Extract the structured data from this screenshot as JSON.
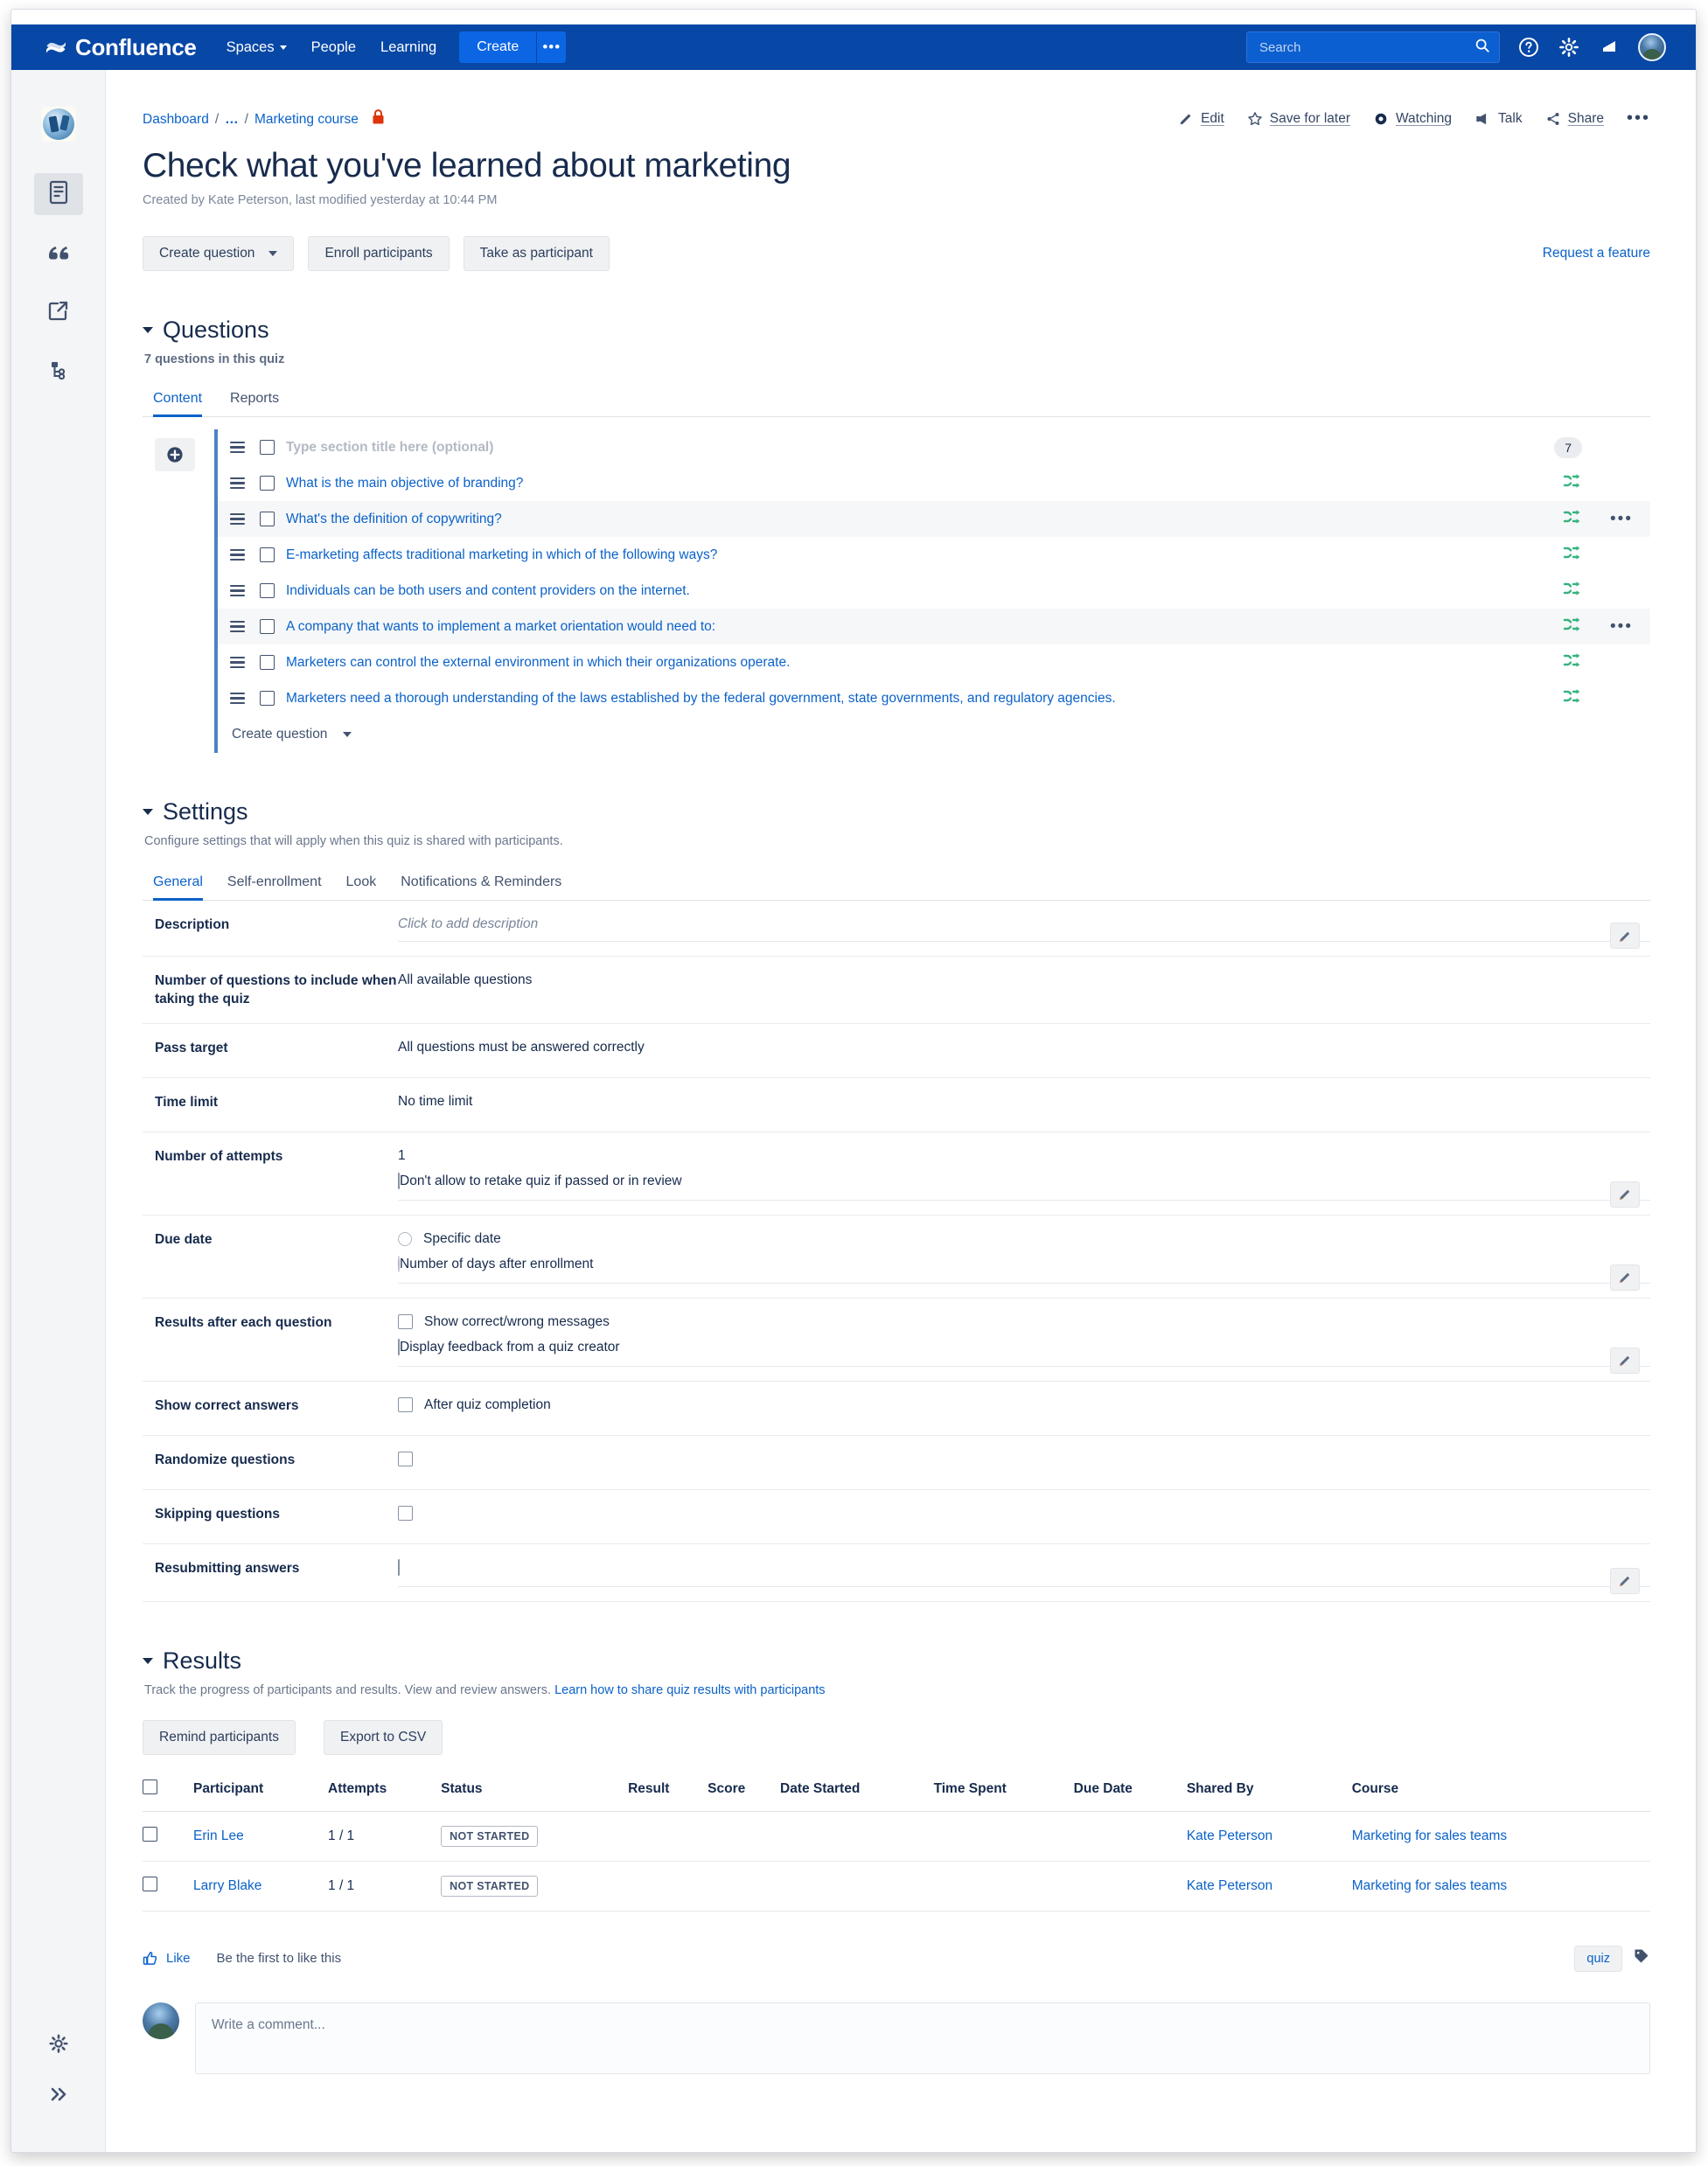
{
  "nav": {
    "brand": "Confluence",
    "items": [
      {
        "label": "Spaces",
        "has_caret": true
      },
      {
        "label": "People",
        "has_caret": false
      },
      {
        "label": "Learning",
        "has_caret": false
      }
    ],
    "create_label": "Create",
    "create_more_label": "•••",
    "search_placeholder": "Search",
    "icons": [
      "search-icon",
      "help-icon",
      "settings-icon",
      "notifications-icon",
      "profile-avatar"
    ]
  },
  "sidebar": {
    "items": [
      {
        "name": "space-logo",
        "label": "Marketing course space"
      },
      {
        "name": "pages-icon",
        "label": "Pages",
        "active": true
      },
      {
        "name": "blog-quote-icon",
        "label": "Blog"
      },
      {
        "name": "shortcut-link-icon",
        "label": "Shortcut"
      },
      {
        "name": "page-tree-icon",
        "label": "Page tree"
      }
    ],
    "bottom": [
      {
        "name": "space-settings-icon",
        "label": "Space settings"
      },
      {
        "name": "expand-sidebar-icon",
        "label": "Expand sidebar"
      }
    ]
  },
  "breadcrumb": {
    "dashboard": "Dashboard",
    "sep": "/",
    "dots": "…",
    "space": "Marketing course",
    "restricted_icon": "lock-icon"
  },
  "page": {
    "title": "Check what you've learned about marketing",
    "meta": "Created by Kate Peterson, last modified yesterday at 10:44 PM"
  },
  "page_actions": [
    {
      "label": "Edit",
      "icon": "pencil-icon"
    },
    {
      "label": "Save for later",
      "icon": "star-icon"
    },
    {
      "label": "Watching",
      "icon": "eye-icon"
    },
    {
      "label": "Talk",
      "icon": "megaphone-icon"
    },
    {
      "label": "Share",
      "icon": "share-icon"
    },
    {
      "label": "•••",
      "icon": "more-actions-icon"
    }
  ],
  "toolbar": {
    "create_question": "Create question",
    "enroll_participants": "Enroll participants",
    "take_as_participant": "Take as participant",
    "request_feature": "Request a feature"
  },
  "questions_section": {
    "title": "Questions",
    "subtitle": "7 questions in this quiz",
    "tabs": [
      {
        "label": "Content",
        "active": true
      },
      {
        "label": "Reports",
        "active": false
      }
    ],
    "section_row": {
      "placeholder": "Type section title here (optional)",
      "count_badge": "7"
    },
    "items": [
      {
        "text": "What is the main objective of branding?",
        "alt": false,
        "has_dots": false
      },
      {
        "text": "What's the definition of copywriting?",
        "alt": true,
        "has_dots": true
      },
      {
        "text": "E-marketing affects traditional marketing in which of the following ways?",
        "alt": false,
        "has_dots": false
      },
      {
        "text": "Individuals can be both users and content providers on the internet.",
        "alt": false,
        "has_dots": false
      },
      {
        "text": "A company that wants to implement a market orientation would need to:",
        "alt": true,
        "has_dots": true
      },
      {
        "text": "Marketers can control the external environment in which their organizations operate.",
        "alt": false,
        "has_dots": false
      },
      {
        "text": "Marketers need a thorough understanding of the laws established by the federal government, state governments, and regulatory agencies.",
        "alt": false,
        "has_dots": false
      }
    ],
    "create_question_footer": "Create question"
  },
  "settings_section": {
    "title": "Settings",
    "subtitle": "Configure settings that will apply when this quiz is shared with participants.",
    "tabs": [
      {
        "label": "General",
        "active": true
      },
      {
        "label": "Self-enrollment",
        "active": false
      },
      {
        "label": "Look",
        "active": false
      },
      {
        "label": "Notifications & Reminders",
        "active": false
      }
    ],
    "rows": {
      "description": {
        "label": "Description",
        "placeholder": "Click to add description"
      },
      "num_questions": {
        "label": "Number of questions to include when taking the quiz",
        "value": "All available questions"
      },
      "pass_target": {
        "label": "Pass target",
        "value": "All questions must be answered correctly"
      },
      "time_limit": {
        "label": "Time limit",
        "value": "No time limit"
      },
      "attempts": {
        "label": "Number of attempts",
        "value": "1",
        "checkbox_label": "Don't allow to retake quiz if passed or in review"
      },
      "due_date": {
        "label": "Due date",
        "option1": "Specific date",
        "option2": "Number of days after enrollment"
      },
      "results_after": {
        "label": "Results after each question",
        "option1": "Show correct/wrong messages",
        "option2": "Display feedback from a quiz creator"
      },
      "show_answers": {
        "label": "Show correct answers",
        "option1": "After quiz completion"
      },
      "randomize": {
        "label": "Randomize questions"
      },
      "skipping": {
        "label": "Skipping questions"
      },
      "resubmitting": {
        "label": "Resubmitting answers"
      }
    }
  },
  "results_section": {
    "title": "Results",
    "subtitle_text": "Track the progress of participants and results. View and review answers. ",
    "subtitle_link": "Learn how to share quiz results with participants",
    "buttons": {
      "remind": "Remind participants",
      "export": "Export to CSV"
    },
    "columns": [
      "Participant",
      "Attempts",
      "Status",
      "Result",
      "Score",
      "Date Started",
      "Time Spent",
      "Due Date",
      "Shared By",
      "Course"
    ],
    "rows": [
      {
        "participant": "Erin Lee",
        "attempts": "1 / 1",
        "status": "NOT STARTED",
        "result": "",
        "score": "",
        "date_started": "",
        "time_spent": "",
        "due_date": "",
        "shared_by": "Kate Peterson",
        "course": "Marketing for sales teams"
      },
      {
        "participant": "Larry Blake",
        "attempts": "1 / 1",
        "status": "NOT STARTED",
        "result": "",
        "score": "",
        "date_started": "",
        "time_spent": "",
        "due_date": "",
        "shared_by": "Kate Peterson",
        "course": "Marketing for sales teams"
      }
    ]
  },
  "footer": {
    "like_label": "Like",
    "like_note": "Be the first to like this",
    "tag": "quiz",
    "comment_placeholder": "Write a comment..."
  },
  "colors": {
    "nav_blue": "#0747a6",
    "link_blue": "#0b62c9",
    "accent_green": "#36b37e",
    "text_dark": "#172b4d"
  }
}
